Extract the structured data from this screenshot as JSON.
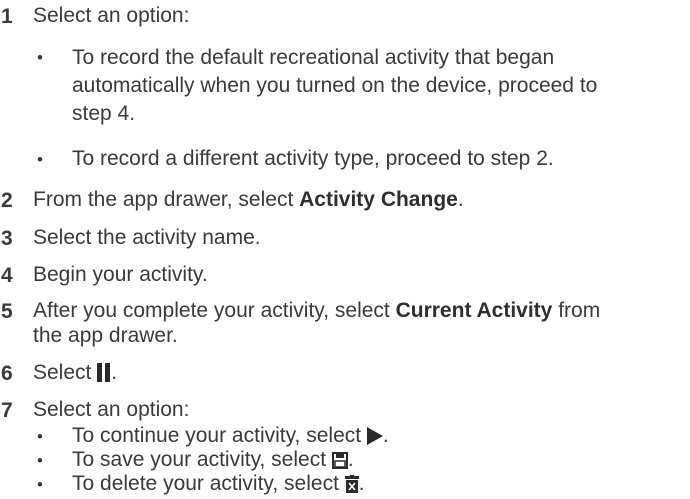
{
  "steps": [
    {
      "number": "1",
      "text": "Select an option:",
      "bullets": [
        {
          "line1": "To record the default recreational activity that began",
          "line2": "automatically when you turned on the device, proceed to",
          "line3": "step 4."
        },
        {
          "text": "To record a different activity type, proceed to step 2."
        }
      ]
    },
    {
      "number": "2",
      "prefix": "From the app drawer, select ",
      "bold": "Activity Change",
      "suffix": "."
    },
    {
      "number": "3",
      "text": "Select the activity name."
    },
    {
      "number": "4",
      "text": "Begin your activity."
    },
    {
      "number": "5",
      "prefix": "After you complete your activity, select ",
      "bold": "Current Activity",
      "suffix": " from",
      "line2": "the app drawer."
    },
    {
      "number": "6",
      "prefix": "Select ",
      "icon": "pause-icon",
      "suffix": "."
    },
    {
      "number": "7",
      "text": "Select an option:",
      "bullets": [
        {
          "prefix": "To continue your activity, select ",
          "icon": "play-icon",
          "suffix": "."
        },
        {
          "prefix": "To save your activity, select ",
          "icon": "save-icon",
          "suffix": "."
        },
        {
          "prefix": "To delete your activity, select ",
          "icon": "delete-icon",
          "suffix": "."
        }
      ]
    }
  ],
  "bullet_char": "•",
  "text_color": "#3a3a3a"
}
